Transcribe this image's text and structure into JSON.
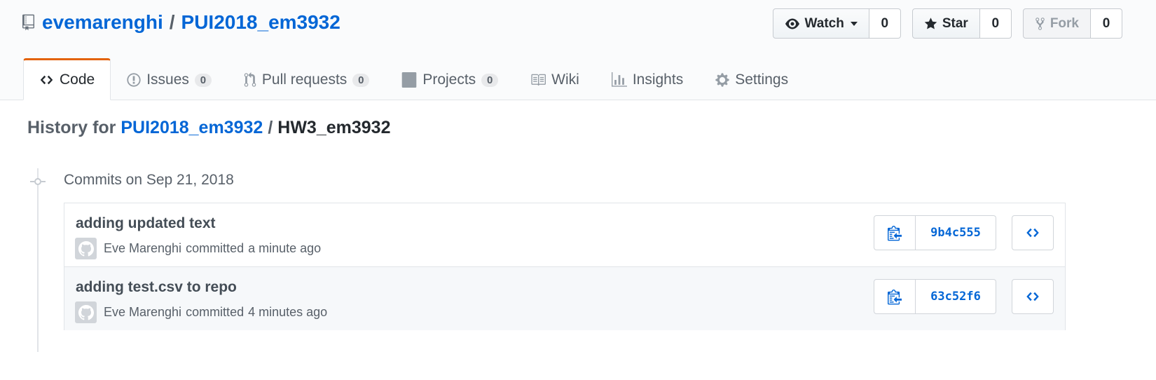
{
  "repo": {
    "owner": "evemarenghi",
    "separator": "/",
    "name": "PUI2018_em3932"
  },
  "actions": {
    "watch_label": "Watch",
    "watch_count": "0",
    "star_label": "Star",
    "star_count": "0",
    "fork_label": "Fork",
    "fork_count": "0"
  },
  "nav": {
    "tabs": [
      {
        "label": "Code",
        "icon": "code-icon",
        "selected": true
      },
      {
        "label": "Issues",
        "icon": "issue-icon",
        "counter": "0"
      },
      {
        "label": "Pull requests",
        "icon": "pull-request-icon",
        "counter": "0"
      },
      {
        "label": "Projects",
        "icon": "project-icon",
        "counter": "0"
      },
      {
        "label": "Wiki",
        "icon": "book-icon"
      },
      {
        "label": "Insights",
        "icon": "graph-icon"
      },
      {
        "label": "Settings",
        "icon": "gear-icon"
      }
    ]
  },
  "history": {
    "prefix": "History for",
    "repo_link": "PUI2018_em3932",
    "separator": "/",
    "path": "HW3_em3932"
  },
  "commit_group": {
    "title": "Commits on Sep 21, 2018"
  },
  "commits": [
    {
      "message": "adding updated text",
      "author": "Eve Marenghi",
      "verb": "committed",
      "time": "a minute ago",
      "sha": "9b4c555"
    },
    {
      "message": "adding test.csv to repo",
      "author": "Eve Marenghi",
      "verb": "committed",
      "time": "4 minutes ago",
      "sha": "63c52f6"
    }
  ],
  "colors": {
    "link": "#0366d6",
    "selected_tab_accent": "#e36209",
    "text_muted": "#586069"
  }
}
